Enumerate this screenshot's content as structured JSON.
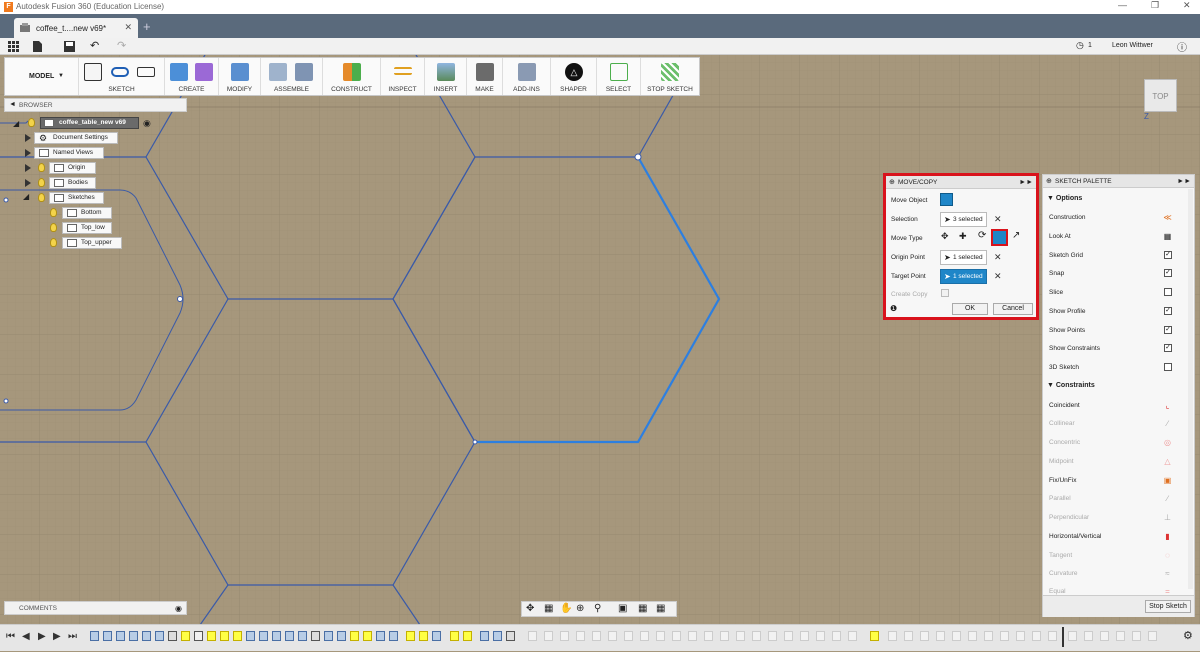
{
  "app": {
    "title": "Autodesk Fusion 360 (Education License)"
  },
  "tab": {
    "label": "coffee_t....new v69*"
  },
  "user": {
    "name": "Leon Wittwer",
    "notifications": "1"
  },
  "toolbar": {
    "workspace": "MODEL",
    "groups": [
      "SKETCH",
      "CREATE",
      "MODIFY",
      "ASSEMBLE",
      "CONSTRUCT",
      "INSPECT",
      "INSERT",
      "MAKE",
      "ADD-INS",
      "SHAPER",
      "SELECT",
      "STOP SKETCH"
    ]
  },
  "browser": {
    "title": "BROWSER",
    "root": "coffee_table_new v69",
    "items": [
      "Document Settings",
      "Named Views",
      "Origin",
      "Bodies",
      "Sketches"
    ],
    "sketches": [
      "Bottom",
      "Top_low",
      "Top_upper"
    ]
  },
  "dialog": {
    "title": "MOVE/COPY",
    "move_object_label": "Move Object",
    "selection_label": "Selection",
    "selection_value": "3 selected",
    "move_type_label": "Move Type",
    "origin_point_label": "Origin Point",
    "origin_point_value": "1 selected",
    "target_point_label": "Target Point",
    "target_point_value": "1 selected",
    "create_copy_label": "Create Copy",
    "ok": "OK",
    "cancel": "Cancel"
  },
  "palette": {
    "title": "SKETCH PALETTE",
    "options_title": "Options",
    "options": [
      {
        "label": "Construction",
        "control": "icon"
      },
      {
        "label": "Look At",
        "control": "icon"
      },
      {
        "label": "Sketch Grid",
        "checked": true
      },
      {
        "label": "Snap",
        "checked": true
      },
      {
        "label": "Slice",
        "checked": false
      },
      {
        "label": "Show Profile",
        "checked": true
      },
      {
        "label": "Show Points",
        "checked": true
      },
      {
        "label": "Show Constraints",
        "checked": true
      },
      {
        "label": "3D Sketch",
        "checked": false
      }
    ],
    "constraints_title": "Constraints",
    "constraints": [
      {
        "label": "Coincident",
        "enabled": true
      },
      {
        "label": "Collinear",
        "enabled": false
      },
      {
        "label": "Concentric",
        "enabled": false
      },
      {
        "label": "Midpoint",
        "enabled": false
      },
      {
        "label": "Fix/UnFix",
        "enabled": true
      },
      {
        "label": "Parallel",
        "enabled": false
      },
      {
        "label": "Perpendicular",
        "enabled": false
      },
      {
        "label": "Horizontal/Vertical",
        "enabled": true
      },
      {
        "label": "Tangent",
        "enabled": false
      },
      {
        "label": "Curvature",
        "enabled": false
      },
      {
        "label": "Equal",
        "enabled": false
      }
    ],
    "stop_sketch": "Stop Sketch"
  },
  "comments": {
    "title": "COMMENTS"
  },
  "viewcube": {
    "face": "TOP",
    "axis": "Z"
  },
  "colors": {
    "accent": "#1f86c8",
    "highlight": "#d9131c",
    "canvas": "#a6977c",
    "sketch_line": "#3a5aa8",
    "selected_line": "#2d7fe0"
  }
}
